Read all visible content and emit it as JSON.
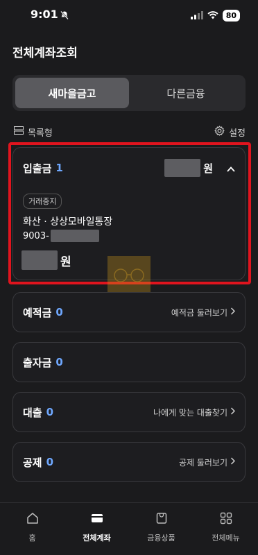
{
  "status": {
    "time": "9:01",
    "battery": "80"
  },
  "title": "전체계좌조회",
  "segment": {
    "tabs": [
      "새마을금고",
      "다른금융"
    ]
  },
  "toolbar": {
    "list_label": "목록형",
    "settings_label": "설정"
  },
  "deposit": {
    "name": "입출금",
    "count": "1",
    "won": "원",
    "badge": "거래중지",
    "account_name": "화산 · 상상모바일통장",
    "account_prefix": "9003-",
    "balance_won": "원"
  },
  "categories": [
    {
      "name": "예적금",
      "count": "0",
      "link": "예적금 둘러보기"
    },
    {
      "name": "출자금",
      "count": "0",
      "link": ""
    },
    {
      "name": "대출",
      "count": "0",
      "link": "나에게 맞는 대출찾기"
    },
    {
      "name": "공제",
      "count": "0",
      "link": "공제 둘러보기"
    }
  ],
  "tabbar": {
    "tabs": [
      "홈",
      "전체계좌",
      "금융상품",
      "전체메뉴"
    ]
  },
  "colors": {
    "accent_count": "#6fa8ff",
    "highlight": "#e0141e",
    "background": "#1b1b1d"
  }
}
